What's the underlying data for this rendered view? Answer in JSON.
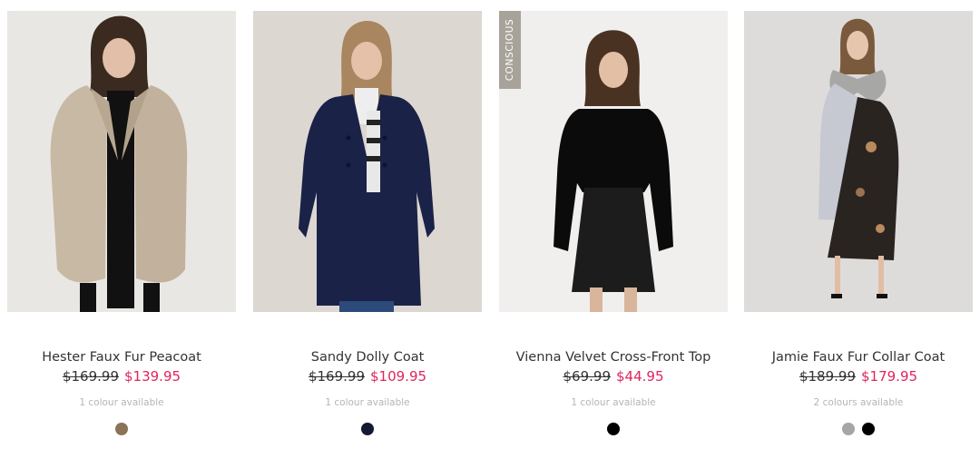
{
  "products": [
    {
      "name": "Hester Faux Fur Peacoat",
      "old_price": "$169.99",
      "new_price": "$139.95",
      "availability": "1 colour available",
      "badge": "",
      "swatches": [
        "#8a7356"
      ]
    },
    {
      "name": "Sandy Dolly Coat",
      "old_price": "$169.99",
      "new_price": "$109.95",
      "availability": "1 colour available",
      "badge": "",
      "swatches": [
        "#141a33"
      ]
    },
    {
      "name": "Vienna Velvet Cross-Front Top",
      "old_price": "$69.99",
      "new_price": "$44.95",
      "availability": "1 colour available",
      "badge": "CONSCIOUS",
      "swatches": [
        "#000000"
      ]
    },
    {
      "name": "Jamie Faux Fur Collar Coat",
      "old_price": "$189.99",
      "new_price": "$179.95",
      "availability": "2 colours available",
      "badge": "",
      "swatches": [
        "#a6a6a6",
        "#000000"
      ]
    }
  ],
  "colors": {
    "sale_price": "#e0245e",
    "availability_text": "#b5b5b5",
    "badge_bg": "#a8a39a"
  }
}
